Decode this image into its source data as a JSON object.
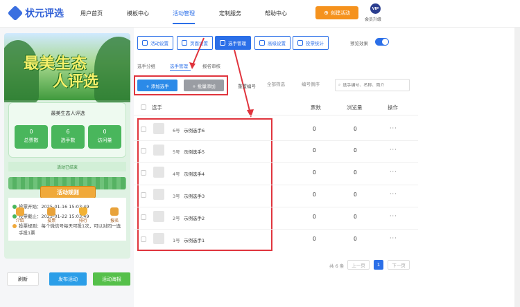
{
  "logo": {
    "text": "状元评选"
  },
  "nav": [
    {
      "label": "用户首页"
    },
    {
      "label": "模板中心"
    },
    {
      "label": "活动管理"
    },
    {
      "label": "定制服务"
    },
    {
      "label": "帮助中心"
    }
  ],
  "header": {
    "create_button": "创建活动",
    "vip_badge": "VIP",
    "vip_label": "会员升级"
  },
  "preview": {
    "banner_line1": "最美生态",
    "banner_line2": "人评选",
    "title": "最美生态人评选",
    "stats": [
      {
        "value": "0",
        "label": "总票数"
      },
      {
        "value": "6",
        "label": "选手数"
      },
      {
        "value": "0",
        "label": "访问量"
      }
    ],
    "status": "活动已结束",
    "rules_title": "活动规则",
    "rules": [
      {
        "text": "投票开始：2025-01-16 15:03:49",
        "color": "#49b65c"
      },
      {
        "text": "投票截止：2025-01-22 15:03:49",
        "color": "#49b65c"
      },
      {
        "text": "投票规则：每个微信号每天可投1次，可以对同一选手投1票",
        "color": "#f0a93a"
      }
    ],
    "bottom_nav": [
      {
        "label": "介绍",
        "icon": "intro-icon"
      },
      {
        "label": "投票",
        "icon": "vote-icon"
      },
      {
        "label": "排行",
        "icon": "trophy-icon"
      },
      {
        "label": "报名",
        "icon": "signup-icon"
      }
    ],
    "buttons": {
      "refresh": "刷新",
      "publish": "发布活动",
      "poster": "活动海报"
    }
  },
  "tabs": [
    {
      "label": "活动设置"
    },
    {
      "label": "页面设置"
    },
    {
      "label": "选手管理"
    },
    {
      "label": "高级设置"
    },
    {
      "label": "投票统计"
    }
  ],
  "preview_toggle": {
    "label": "预览效果",
    "on": true
  },
  "subtabs": [
    {
      "label": "选手分组"
    },
    {
      "label": "选手管理"
    },
    {
      "label": "报名审核"
    }
  ],
  "toolbar": {
    "add": "+ 添加选手",
    "batch_add": "+ 批量添加",
    "reset": "重置编号",
    "filter_all": "全部筛选",
    "sort": "编号倒序",
    "search_placeholder": "选手编号、名称、简介"
  },
  "table": {
    "headers": {
      "player": "选手",
      "votes": "票数",
      "views": "浏览量",
      "actions": "操作"
    },
    "rows": [
      {
        "no": "6号",
        "name": "示例选手6",
        "votes": "0",
        "views": "0",
        "more": "···"
      },
      {
        "no": "5号",
        "name": "示例选手5",
        "votes": "0",
        "views": "0",
        "more": "···"
      },
      {
        "no": "4号",
        "name": "示例选手4",
        "votes": "0",
        "views": "0",
        "more": "···"
      },
      {
        "no": "3号",
        "name": "示例选手3",
        "votes": "0",
        "views": "0",
        "more": "···"
      },
      {
        "no": "2号",
        "name": "示例选手2",
        "votes": "0",
        "views": "0",
        "more": "···"
      },
      {
        "no": "1号",
        "name": "示例选手1",
        "votes": "0",
        "views": "0",
        "more": "···"
      }
    ]
  },
  "pagination": {
    "total": "共 6 条",
    "prev": "上一页",
    "current": "1",
    "next": "下一页"
  },
  "colors": {
    "accent": "#2b6fe8",
    "orange": "#f5921d",
    "green": "#49b65c",
    "highlight": "#e0343d"
  }
}
